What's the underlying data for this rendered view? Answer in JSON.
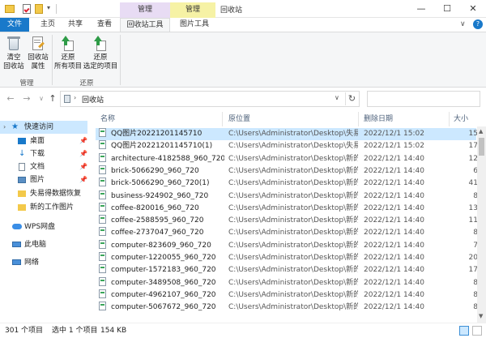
{
  "window": {
    "title": "回收站",
    "context_tabs": [
      "管理",
      "管理"
    ],
    "minimize": "—",
    "maximize": "☐",
    "close": "✕"
  },
  "ribbon_tabs": {
    "file": "文件",
    "home": "主页",
    "share": "共享",
    "view": "查看",
    "recycle_tools": "回收站工具",
    "picture_tools": "图片工具"
  },
  "ribbon": {
    "empty_bin_line1": "清空",
    "empty_bin_line2": "回收站",
    "properties_line1": "回收站",
    "properties_line2": "属性",
    "group_manage": "管理",
    "restore_all_line1": "还原",
    "restore_all_line2": "所有项目",
    "restore_sel_line1": "还原",
    "restore_sel_line2": "选定的项目",
    "group_restore": "还原"
  },
  "address": {
    "path": "回收站",
    "back": "←",
    "forward": "→",
    "dropdown": "∨",
    "up": "↑",
    "addr_dropdown": "∨",
    "refresh": "↻"
  },
  "nav": {
    "quick_access": "快速访问",
    "desktop": "桌面",
    "downloads": "下载",
    "documents": "文档",
    "pictures": "图片",
    "lost_data": "失易得数据恢复",
    "new_work_pics": "新的工作图片",
    "wps": "WPS网盘",
    "this_pc": "此电脑",
    "network": "网络"
  },
  "columns": {
    "name": "名称",
    "location": "原位置",
    "deleted": "删除日期",
    "size": "大小"
  },
  "files": [
    {
      "name": "QQ图片20221201145710",
      "loc": "C:\\Users\\Administrator\\Desktop\\失易...",
      "date": "2022/12/1 15:02",
      "size": "15"
    },
    {
      "name": "QQ图片20221201145710(1)",
      "loc": "C:\\Users\\Administrator\\Desktop\\失易...",
      "date": "2022/12/1 15:02",
      "size": "17"
    },
    {
      "name": "architecture-4182588_960_720",
      "loc": "C:\\Users\\Administrator\\Desktop\\新的...",
      "date": "2022/12/1 14:40",
      "size": "12"
    },
    {
      "name": "brick-5066290_960_720",
      "loc": "C:\\Users\\Administrator\\Desktop\\新的...",
      "date": "2022/12/1 14:40",
      "size": "6"
    },
    {
      "name": "brick-5066290_960_720(1)",
      "loc": "C:\\Users\\Administrator\\Desktop\\新的...",
      "date": "2022/12/1 14:40",
      "size": "41"
    },
    {
      "name": "business-924902_960_720",
      "loc": "C:\\Users\\Administrator\\Desktop\\新的...",
      "date": "2022/12/1 14:40",
      "size": "8"
    },
    {
      "name": "coffee-820016_960_720",
      "loc": "C:\\Users\\Administrator\\Desktop\\新的...",
      "date": "2022/12/1 14:40",
      "size": "13"
    },
    {
      "name": "coffee-2588595_960_720",
      "loc": "C:\\Users\\Administrator\\Desktop\\新的...",
      "date": "2022/12/1 14:40",
      "size": "11"
    },
    {
      "name": "coffee-2737047_960_720",
      "loc": "C:\\Users\\Administrator\\Desktop\\新的...",
      "date": "2022/12/1 14:40",
      "size": "8"
    },
    {
      "name": "computer-823609_960_720",
      "loc": "C:\\Users\\Administrator\\Desktop\\新的...",
      "date": "2022/12/1 14:40",
      "size": "7"
    },
    {
      "name": "computer-1220055_960_720",
      "loc": "C:\\Users\\Administrator\\Desktop\\新的...",
      "date": "2022/12/1 14:40",
      "size": "20"
    },
    {
      "name": "computer-1572183_960_720",
      "loc": "C:\\Users\\Administrator\\Desktop\\新的...",
      "date": "2022/12/1 14:40",
      "size": "17"
    },
    {
      "name": "computer-3489508_960_720",
      "loc": "C:\\Users\\Administrator\\Desktop\\新的...",
      "date": "2022/12/1 14:40",
      "size": "8"
    },
    {
      "name": "computer-4962107_960_720",
      "loc": "C:\\Users\\Administrator\\Desktop\\新的...",
      "date": "2022/12/1 14:40",
      "size": "8"
    },
    {
      "name": "computer-5067672_960_720",
      "loc": "C:\\Users\\Administrator\\Desktop\\新的...",
      "date": "2022/12/1 14:40",
      "size": "8"
    }
  ],
  "status": {
    "count": "301 个项目",
    "selected": "选中 1 个项目",
    "size": "154 KB"
  },
  "colors": {
    "accent": "#1979ca",
    "manage_tab1": "#e8dcf4",
    "manage_tab2": "#f6f2a5",
    "selection": "#cce8ff"
  }
}
